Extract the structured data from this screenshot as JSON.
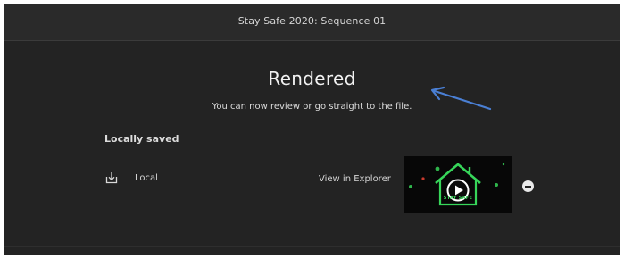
{
  "window": {
    "title": "Stay Safe 2020: Sequence 01"
  },
  "main": {
    "heading": "Rendered",
    "subheading": "You can now review or go straight to the file."
  },
  "saved": {
    "section_label": "Locally saved",
    "items": [
      {
        "icon": "download-icon",
        "label": "Local",
        "action_label": "View in Explorer",
        "thumbnail_text": "STAY SAFE",
        "thumbnail_icon": "play-icon",
        "remove_icon": "minus-circle-icon"
      }
    ]
  },
  "colors": {
    "background": "#232323",
    "titlebar": "#2a2a2a",
    "text": "#e6e6e6",
    "thumbnail_accent": "#37d65a",
    "annotation_arrow": "#4a7fd4"
  }
}
